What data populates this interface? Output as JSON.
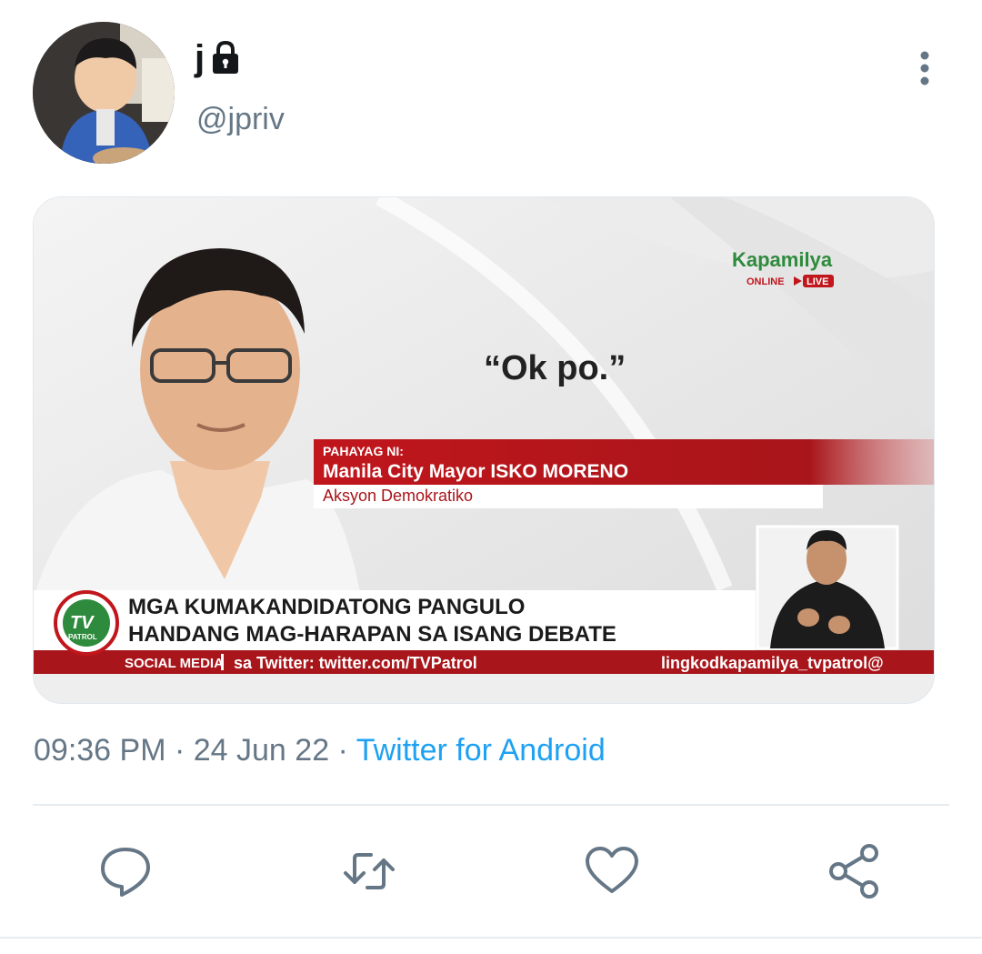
{
  "tweet": {
    "display_name": "j",
    "handle": "@jpriv",
    "time": "09:36 PM",
    "separator1": " · ",
    "date": "24 Jun 22",
    "separator2": " · ",
    "source": "Twitter for Android"
  },
  "media": {
    "brand": "Kapamilya",
    "brand_sub": "ONLINE",
    "live_badge": "LIVE",
    "quote": "“Ok po.”",
    "caption_label": "PAHAYAG NI:",
    "caption_name": "Manila City Mayor ISKO MORENO",
    "caption_party": "Aksyon Demokratiko",
    "headline_line1": "MGA KUMAKANDIDATONG PANGULO",
    "headline_line2": "HANDANG MAG-HARAPAN SA ISANG DEBATE",
    "ticker_label": "SOCIAL MEDIA",
    "ticker_twitter": "sa Twitter: twitter.com/TVPatrol",
    "ticker_ig": "lingkodkapamilya_tvpatrol@",
    "logo_text": "TV",
    "logo_sub": "PATROL"
  },
  "icons": {
    "lock": "lock-icon",
    "more": "more-vertical-icon",
    "reply": "reply-icon",
    "retweet": "retweet-icon",
    "like": "heart-icon",
    "share": "share-icon"
  },
  "colors": {
    "accent": "#1da1f2",
    "muted": "#657786",
    "icon": "#657786",
    "broadcast_red": "#b51a1f"
  }
}
